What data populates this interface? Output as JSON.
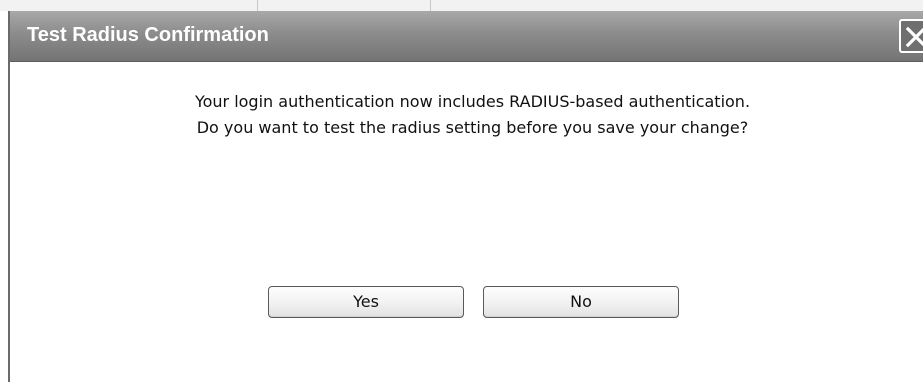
{
  "dialog": {
    "title": "Test Radius Confirmation",
    "close_icon": "close-icon",
    "message_line1": "Your login authentication now includes RADIUS-based authentication.",
    "message_line2": "Do you want to test the radius setting before you save your change?",
    "yes_label": "Yes",
    "no_label": "No"
  },
  "colors": {
    "titlebar": "#8c8c8c",
    "title_text": "#ffffff",
    "body_background": "#ffffff",
    "text": "#111111"
  }
}
